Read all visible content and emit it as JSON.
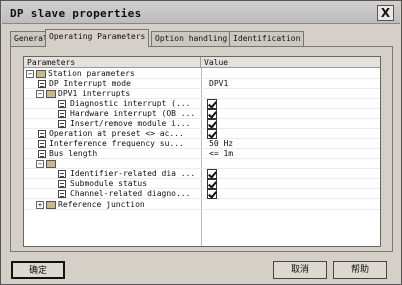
{
  "window": {
    "title": "DP slave properties",
    "close_label": "X"
  },
  "tabs": [
    {
      "label": "General",
      "active": false
    },
    {
      "label": "Operating Parameters",
      "active": true
    },
    {
      "label": "Option handling",
      "active": false
    },
    {
      "label": "Identification",
      "active": false
    }
  ],
  "grid": {
    "col_parameters": "Parameters",
    "col_value": "Value",
    "rows": [
      {
        "label": "Station parameters",
        "type": "folder",
        "expanded": true,
        "value": ""
      },
      {
        "label": "DP Interrupt mode",
        "type": "param",
        "value": "DPV1"
      },
      {
        "label": "DPV1 interrupts",
        "type": "folder",
        "expanded": true,
        "value": ""
      },
      {
        "label": "Diagnostic interrupt (...",
        "type": "param",
        "value": "",
        "checkbox": true
      },
      {
        "label": "Hardware interrupt (OB ...",
        "type": "param",
        "value": "",
        "checkbox": true
      },
      {
        "label": "Insert/remove module i...",
        "type": "param",
        "value": "",
        "checkbox": true
      },
      {
        "label": "Operation at preset <> ac...",
        "type": "param",
        "value": "",
        "checkbox": true
      },
      {
        "label": "Interference frequency su...",
        "type": "param",
        "value": "50 Hz"
      },
      {
        "label": "Bus length",
        "type": "param",
        "value": "<= 1m"
      },
      {
        "label": "",
        "type": "folder",
        "expanded": true,
        "value": ""
      },
      {
        "label": "Identifier-related dia ...",
        "type": "param",
        "value": "",
        "checkbox": true
      },
      {
        "label": "Submodule status",
        "type": "param",
        "value": "",
        "checkbox": true
      },
      {
        "label": "Channel-related diagno...",
        "type": "param",
        "value": "",
        "checkbox": true
      },
      {
        "label": "Reference junction",
        "type": "folder",
        "expanded": false,
        "value": ""
      }
    ]
  },
  "buttons": {
    "ok": "确定",
    "cancel": "取消",
    "help": "帮助"
  }
}
